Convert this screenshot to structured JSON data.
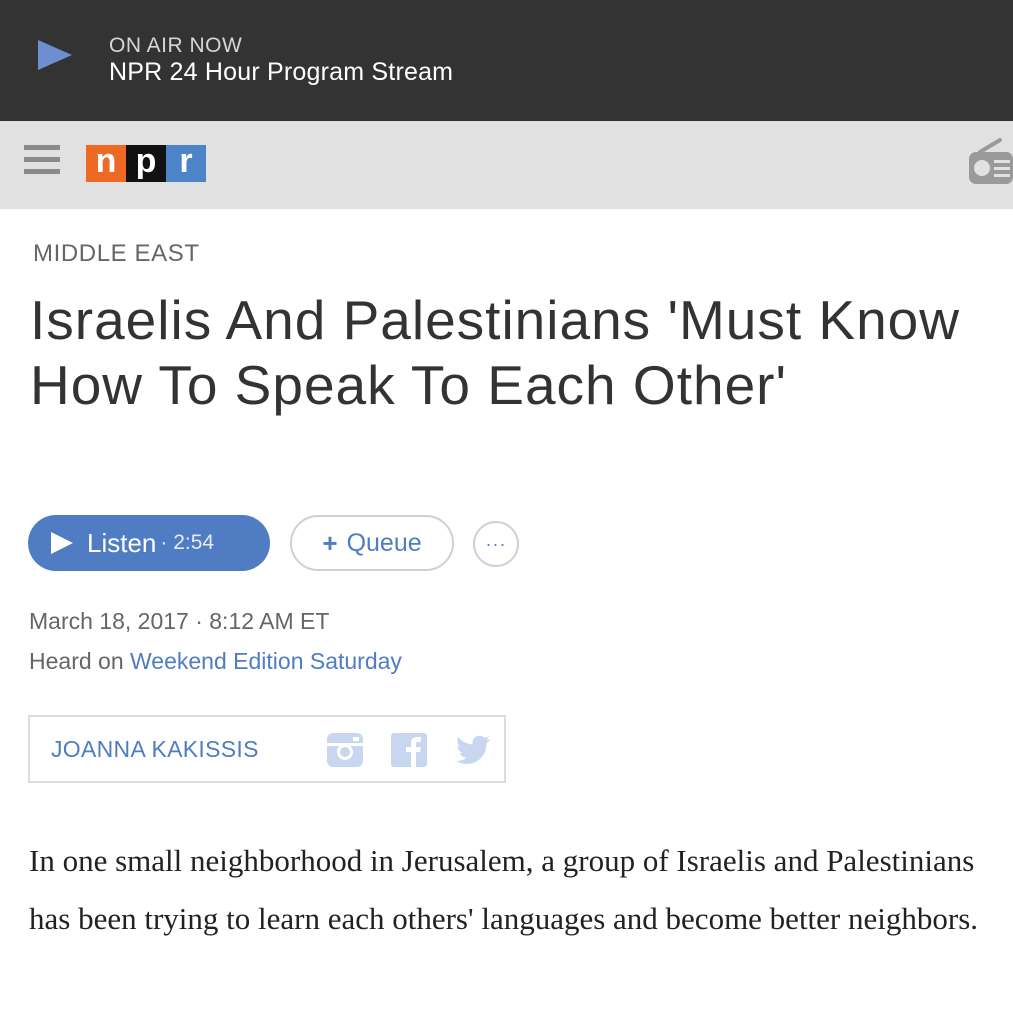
{
  "on_air": {
    "label": "ON AIR NOW",
    "program": "NPR 24 Hour Program Stream"
  },
  "header": {
    "logo_letters": [
      "n",
      "p",
      "r"
    ],
    "logo_colors": [
      "#ee6a24",
      "#111111",
      "#4c84c7"
    ],
    "menu_icon": "hamburger-menu-icon",
    "radio_icon": "radio-icon"
  },
  "article": {
    "section": "MIDDLE EAST",
    "headline": "Israelis And Palestinians 'Must Know How To Speak To Each Other'",
    "listen_label": "Listen",
    "listen_duration": "· 2:54",
    "queue_label": "Queue",
    "queue_plus": "+",
    "more_label": "···",
    "date": "March 18, 2017 · 8:12 AM ET",
    "heard_prefix": "Heard on ",
    "heard_show": "Weekend Edition Saturday",
    "author": "JOANNA KAKISSIS",
    "social_icons": [
      "instagram-icon",
      "facebook-icon",
      "twitter-icon"
    ],
    "body": "In one small neighborhood in Jerusalem, a group of Israelis and Palestinians has been trying to learn each others' languages and become better neighbors."
  },
  "colors": {
    "accent": "#4f7cc3",
    "on_air_bg": "#333333",
    "nav_bg": "#e1e1e1"
  }
}
